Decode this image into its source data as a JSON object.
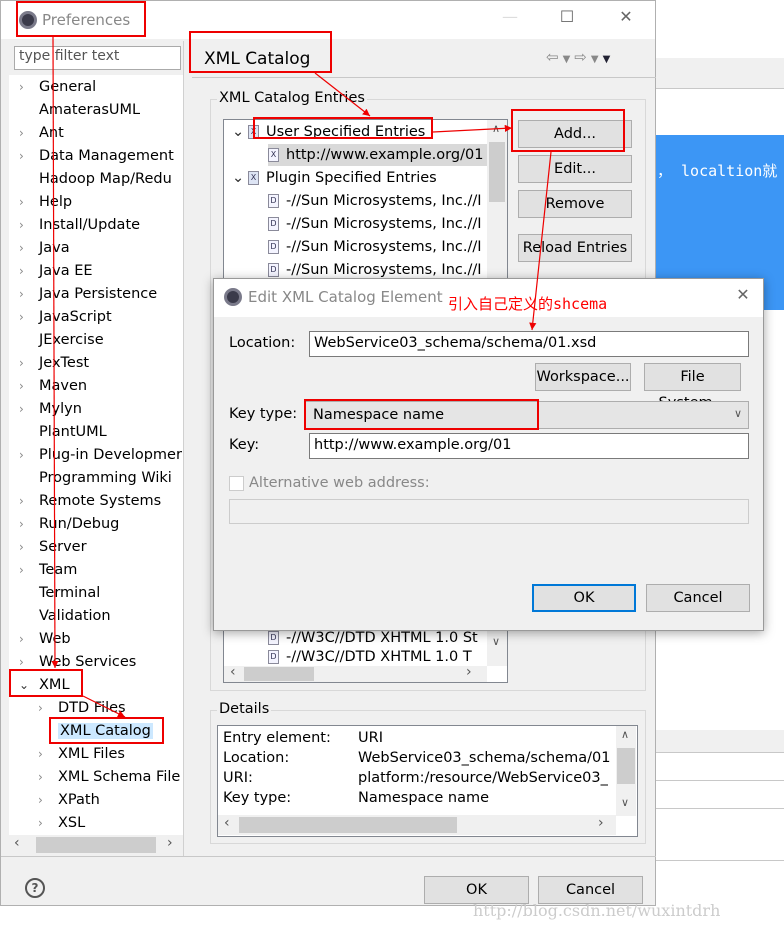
{
  "background": {
    "editor_text": "， localtion就"
  },
  "window": {
    "title": "Preferences",
    "filter_placeholder": "type filter text",
    "tree": [
      {
        "label": "General",
        "arrow": "right",
        "level": 0
      },
      {
        "label": "AmaterasUML",
        "arrow": "none",
        "level": 0
      },
      {
        "label": "Ant",
        "arrow": "right",
        "level": 0
      },
      {
        "label": "Data Management",
        "arrow": "right",
        "level": 0
      },
      {
        "label": "Hadoop Map/Redu",
        "arrow": "none",
        "level": 0
      },
      {
        "label": "Help",
        "arrow": "right",
        "level": 0
      },
      {
        "label": "Install/Update",
        "arrow": "right",
        "level": 0
      },
      {
        "label": "Java",
        "arrow": "right",
        "level": 0
      },
      {
        "label": "Java EE",
        "arrow": "right",
        "level": 0
      },
      {
        "label": "Java Persistence",
        "arrow": "right",
        "level": 0
      },
      {
        "label": "JavaScript",
        "arrow": "right",
        "level": 0
      },
      {
        "label": "JExercise",
        "arrow": "none",
        "level": 0
      },
      {
        "label": "JexTest",
        "arrow": "right",
        "level": 0
      },
      {
        "label": "Maven",
        "arrow": "right",
        "level": 0
      },
      {
        "label": "Mylyn",
        "arrow": "right",
        "level": 0
      },
      {
        "label": "PlantUML",
        "arrow": "none",
        "level": 0
      },
      {
        "label": "Plug-in Developmer",
        "arrow": "right",
        "level": 0
      },
      {
        "label": "Programming Wiki",
        "arrow": "none",
        "level": 0
      },
      {
        "label": "Remote Systems",
        "arrow": "right",
        "level": 0
      },
      {
        "label": "Run/Debug",
        "arrow": "right",
        "level": 0
      },
      {
        "label": "Server",
        "arrow": "right",
        "level": 0
      },
      {
        "label": "Team",
        "arrow": "right",
        "level": 0
      },
      {
        "label": "Terminal",
        "arrow": "none",
        "level": 0
      },
      {
        "label": "Validation",
        "arrow": "none",
        "level": 0
      },
      {
        "label": "Web",
        "arrow": "right",
        "level": 0
      },
      {
        "label": "Web Services",
        "arrow": "right",
        "level": 0
      },
      {
        "label": "XML",
        "arrow": "down",
        "level": 0
      },
      {
        "label": "DTD Files",
        "arrow": "right",
        "level": 1
      },
      {
        "label": "XML Catalog",
        "arrow": "none",
        "level": 1,
        "selected": true
      },
      {
        "label": "XML Files",
        "arrow": "right",
        "level": 1
      },
      {
        "label": "XML Schema File",
        "arrow": "right",
        "level": 1
      },
      {
        "label": "XPath",
        "arrow": "right",
        "level": 1
      },
      {
        "label": "XSL",
        "arrow": "right",
        "level": 1
      }
    ],
    "page_title": "XML Catalog",
    "entries_label": "XML Catalog Entries",
    "entries": [
      {
        "label": "User Specified Entries",
        "arrow": "down",
        "level": 0,
        "icon": "catalog-icon"
      },
      {
        "label": "http://www.example.org/01",
        "arrow": "none",
        "level": 1,
        "icon": "xsd-file-icon",
        "selected": true
      },
      {
        "label": "Plugin Specified Entries",
        "arrow": "down",
        "level": 0,
        "icon": "catalog-icon"
      },
      {
        "label": "-//Sun Microsystems, Inc.//I",
        "arrow": "none",
        "level": 1,
        "icon": "dtd-file-icon"
      },
      {
        "label": "-//Sun Microsystems, Inc.//I",
        "arrow": "none",
        "level": 1,
        "icon": "dtd-file-icon"
      },
      {
        "label": "-//Sun Microsystems, Inc.//I",
        "arrow": "none",
        "level": 1,
        "icon": "dtd-file-icon"
      },
      {
        "label": "-//Sun Microsystems, Inc.//I",
        "arrow": "none",
        "level": 1,
        "icon": "dtd-file-icon"
      }
    ],
    "entries_bottom": [
      "-//W3C//DTD XHTML 1.0 St",
      "-//W3C//DTD XHTML 1.0 T"
    ],
    "buttons": {
      "add": "Add...",
      "edit": "Edit...",
      "remove": "Remove",
      "reload": "Reload Entries"
    },
    "details_label": "Details",
    "details": [
      {
        "key": "Entry element:",
        "value": "URI"
      },
      {
        "key": "Location:",
        "value": "WebService03_schema/schema/01"
      },
      {
        "key": "URI:",
        "value": "platform:/resource/WebService03_"
      },
      {
        "key": "Key type:",
        "value": "Namespace name"
      }
    ],
    "ok": "OK",
    "cancel": "Cancel"
  },
  "dialog": {
    "title": "Edit XML Catalog Element",
    "location_label": "Location:",
    "location_value": "WebService03_schema/schema/01.xsd",
    "workspace_button": "Workspace...",
    "filesystem_button": "File System...",
    "keytype_label": "Key type:",
    "keytype_value": "Namespace name",
    "key_label": "Key:",
    "key_value": "http://www.example.org/01",
    "alt_label": "Alternative web address:",
    "alt_checked": false,
    "ok": "OK",
    "cancel": "Cancel"
  },
  "annotation": {
    "text": "引入自己定义的shcema",
    "color": "#ff0000"
  },
  "watermark": "http://blog.csdn.net/wuxintdrh"
}
